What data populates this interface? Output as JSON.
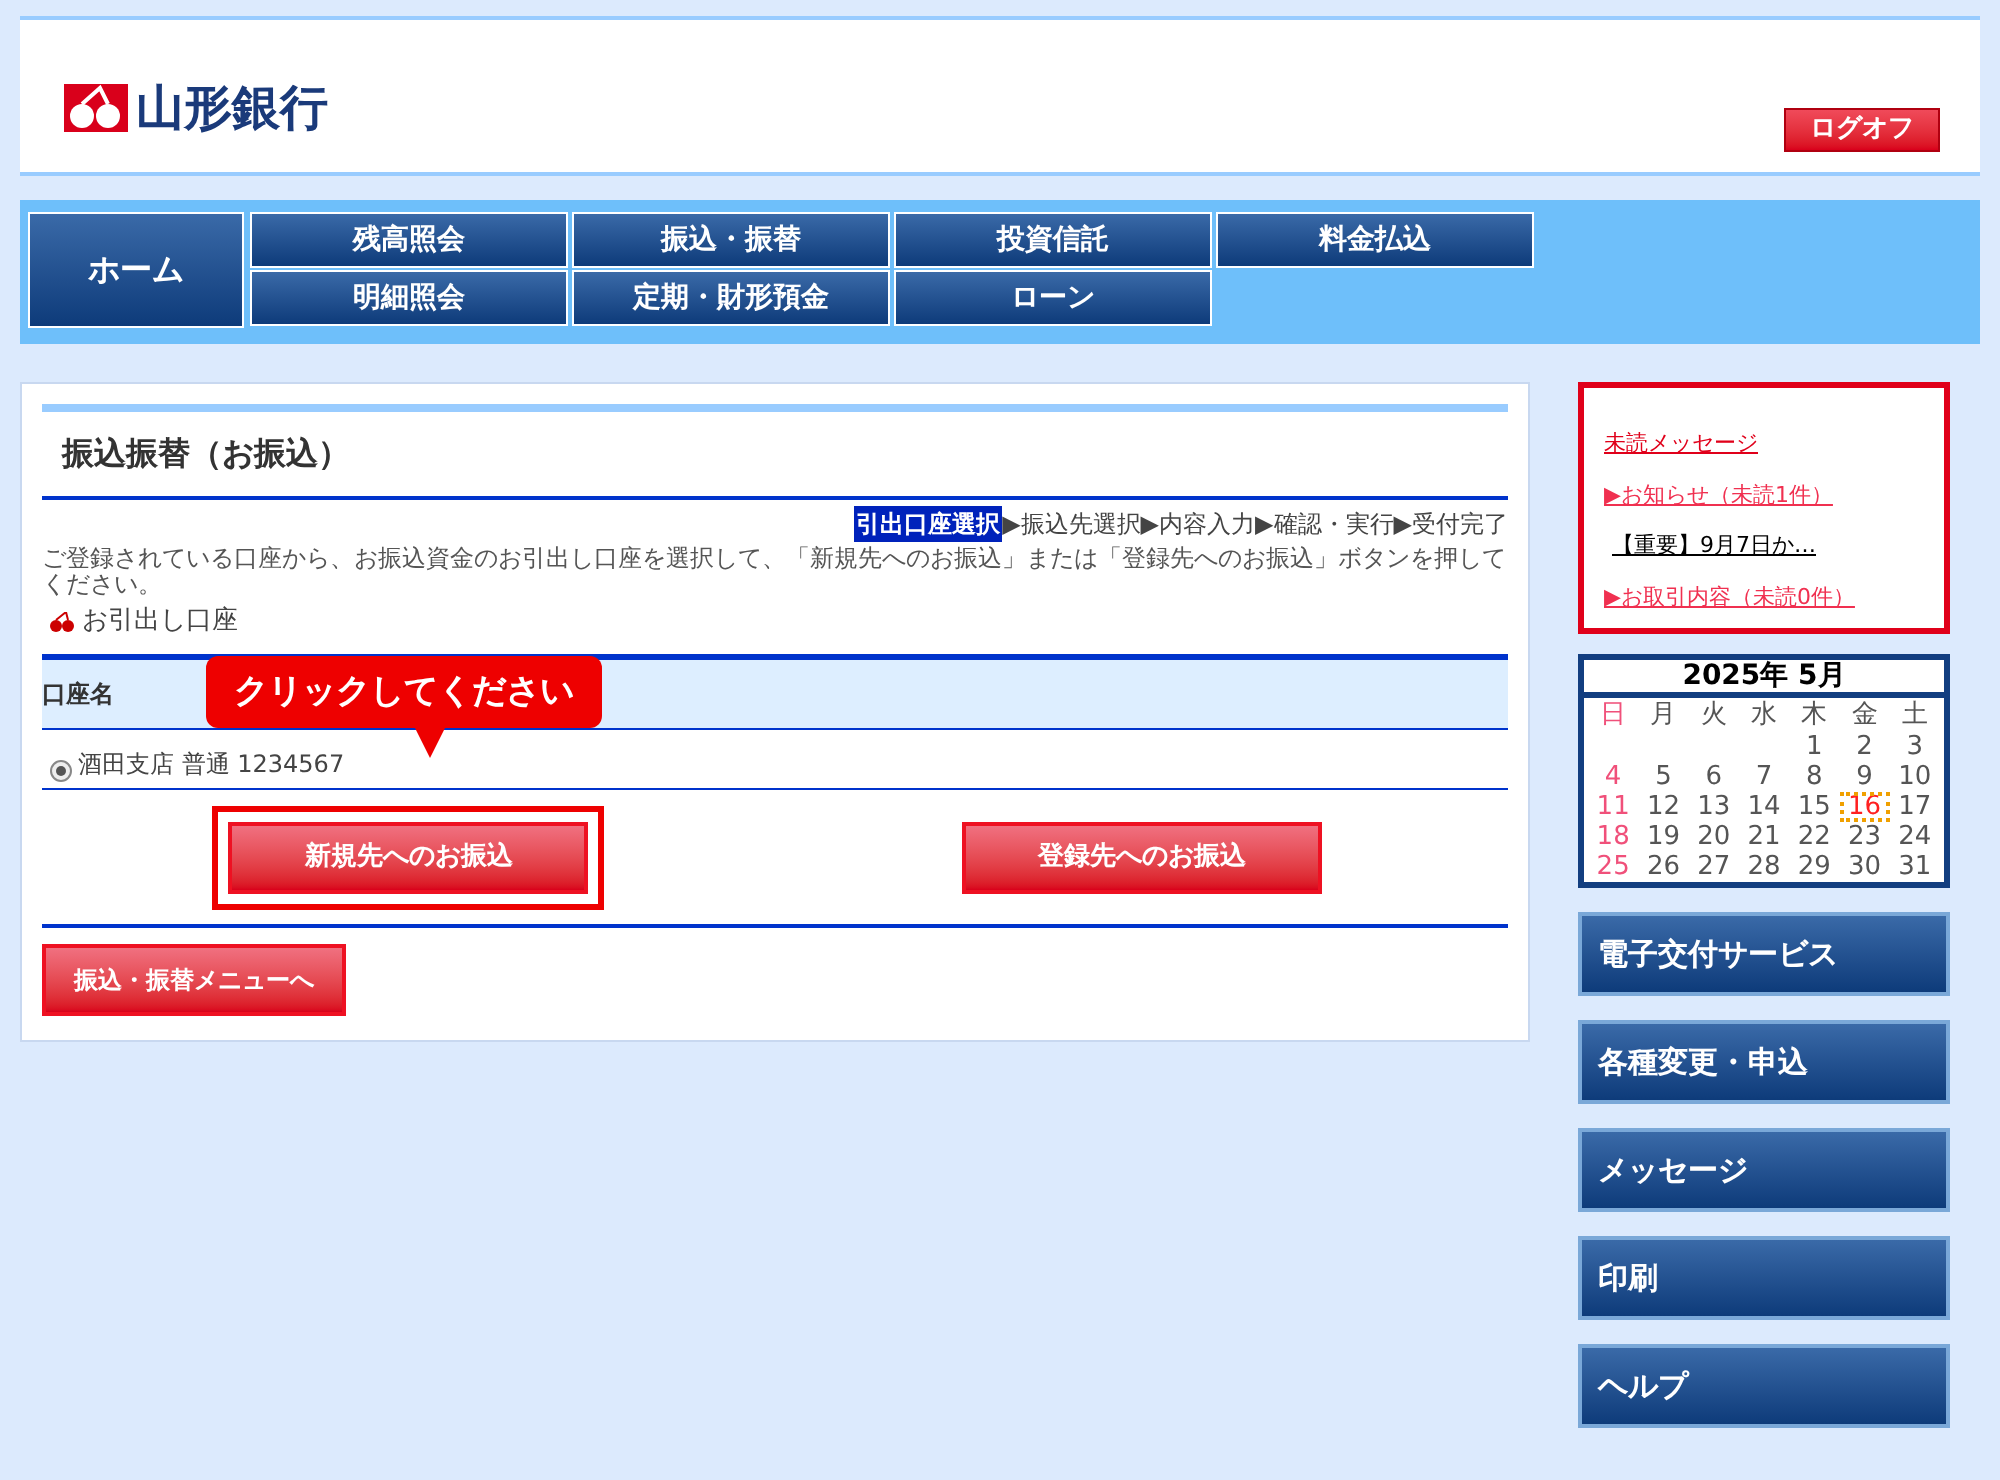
{
  "header": {
    "logo": "山形銀行",
    "logoff": "ログオフ"
  },
  "nav": {
    "home": "ホーム",
    "rows": [
      [
        "残高照会",
        "振込・振替",
        "投資信託",
        "料金払込"
      ],
      [
        "明細照会",
        "定期・財形預金",
        "ローン"
      ]
    ]
  },
  "page": {
    "title": "振込振替（お振込）",
    "separator": "▶",
    "steps": [
      {
        "label": "引出口座選択",
        "selected": true
      },
      {
        "label": "振込先選択",
        "selected": false
      },
      {
        "label": "内容入力",
        "selected": false
      },
      {
        "label": "確認・実行",
        "selected": false
      },
      {
        "label": "受付完了",
        "selected": false
      }
    ],
    "description": "ご登録されている口座から、お振込資金のお引出し口座を選択して、「新規先へのお振込」または「登録先へのお振込」ボタンを押してください。",
    "section": "お引出し口座",
    "table": {
      "header": "口座名",
      "rows": [
        {
          "label": "酒田支店 普通 1234567",
          "selected": true
        }
      ]
    },
    "callout": "クリックしてください",
    "buttons": [
      {
        "label": "新規先へのお振込",
        "highlighted": true
      },
      {
        "label": "登録先へのお振込",
        "highlighted": false
      }
    ],
    "back_button": "振込・振替メニューへ"
  },
  "messages": {
    "title": "未読メッセージ",
    "items": [
      {
        "kind": "category",
        "text": "▶お知らせ（未読1件）"
      },
      {
        "kind": "entry",
        "text": "【重要】9月7日か…"
      },
      {
        "kind": "category",
        "text": "▶お取引内容（未読0件）"
      }
    ]
  },
  "calendar": {
    "title": "2025年 5月",
    "weekdays": [
      "日",
      "月",
      "火",
      "水",
      "木",
      "金",
      "土"
    ],
    "weeks": [
      [
        {
          "day": "1",
          "today": false
        },
        {
          "day": "2",
          "today": false
        },
        {
          "day": "3",
          "today": false
        }
      ],
      [
        {
          "day": "4",
          "today": false
        },
        {
          "day": "5",
          "today": false
        },
        {
          "day": "6",
          "today": false
        },
        {
          "day": "7",
          "today": false
        },
        {
          "day": "8",
          "today": false
        },
        {
          "day": "9",
          "today": false
        },
        {
          "day": "10",
          "today": false
        }
      ],
      [
        {
          "day": "11",
          "today": false
        },
        {
          "day": "12",
          "today": false
        },
        {
          "day": "13",
          "today": false
        },
        {
          "day": "14",
          "today": false
        },
        {
          "day": "15",
          "today": false
        },
        {
          "day": "16",
          "today": true
        },
        {
          "day": "17",
          "today": false
        }
      ],
      [
        {
          "day": "18",
          "today": false
        },
        {
          "day": "19",
          "today": false
        },
        {
          "day": "20",
          "today": false
        },
        {
          "day": "21",
          "today": false
        },
        {
          "day": "22",
          "today": false
        },
        {
          "day": "23",
          "today": false
        },
        {
          "day": "24",
          "today": false
        }
      ],
      [
        {
          "day": "25",
          "today": false
        },
        {
          "day": "26",
          "today": false
        },
        {
          "day": "27",
          "today": false
        },
        {
          "day": "28",
          "today": false
        },
        {
          "day": "29",
          "today": false
        },
        {
          "day": "30",
          "today": false
        },
        {
          "day": "31",
          "today": false
        }
      ]
    ]
  },
  "side_menu": [
    "電子交付サービス",
    "各種変更・申込",
    "メッセージ",
    "印刷",
    "ヘルプ"
  ]
}
